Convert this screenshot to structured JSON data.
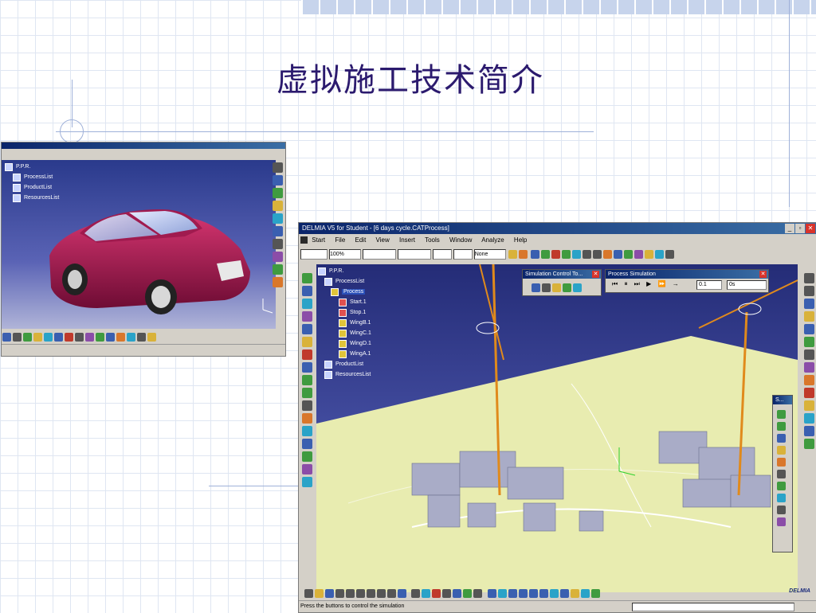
{
  "slide": {
    "title": "虚拟施工技术简介"
  },
  "car_window": {
    "tree": [
      "P.P.R.",
      "ProcessList",
      "ProductList",
      "ResourcesList"
    ]
  },
  "main_window": {
    "title": "DELMIA V5 for Student - [6 days cycle.CATProcess]",
    "menu": [
      "Start",
      "File",
      "Edit",
      "View",
      "Insert",
      "Tools",
      "Window",
      "Analyze",
      "Help"
    ],
    "toolbar": {
      "line_zoom": "100%",
      "layer": "None"
    },
    "tree": [
      {
        "label": "P.P.R.",
        "indent": 0
      },
      {
        "label": "ProcessList",
        "indent": 1
      },
      {
        "label": "Process",
        "indent": 2,
        "selected": true
      },
      {
        "label": "Start.1",
        "indent": 3
      },
      {
        "label": "Stop.1",
        "indent": 3
      },
      {
        "label": "WingB.1",
        "indent": 3
      },
      {
        "label": "WingC.1",
        "indent": 3
      },
      {
        "label": "WingD.1",
        "indent": 3
      },
      {
        "label": "WingA.1",
        "indent": 3
      },
      {
        "label": "ProductList",
        "indent": 1
      },
      {
        "label": "ResourcesList",
        "indent": 1
      }
    ],
    "sim_control": {
      "title": "Simulation Control To..."
    },
    "process_sim": {
      "title": "Process Simulation",
      "step_value": "0.1",
      "time_value": "0s"
    },
    "side_panel": {
      "title": "S..."
    },
    "status_text": "Press the buttons to control the simulation",
    "brand": "DELMIA"
  },
  "colors": {
    "title_text": "#2b1a6e",
    "titlebar": "#0a246a",
    "car_body": "#9a1144",
    "site_ground": "#e8ecb0",
    "crane": "#e08a1c"
  }
}
